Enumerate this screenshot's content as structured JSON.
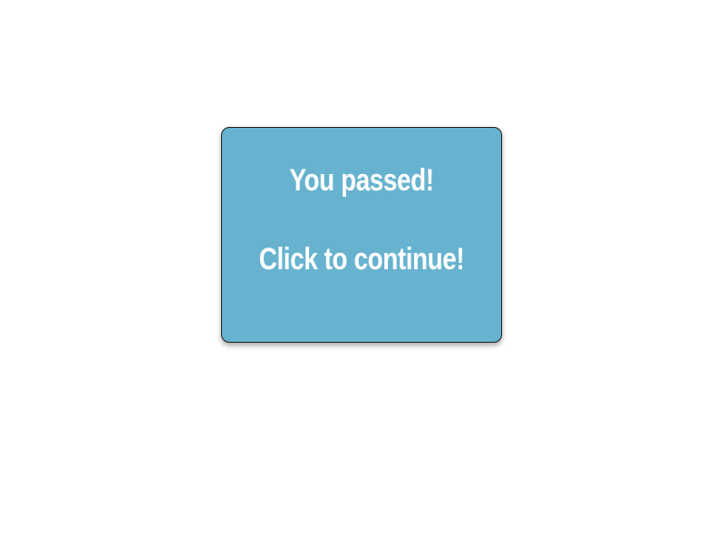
{
  "card": {
    "line1": "You passed!",
    "line2": "Click to continue!",
    "background": "#67b3cf",
    "text_color": "#ffffff"
  }
}
